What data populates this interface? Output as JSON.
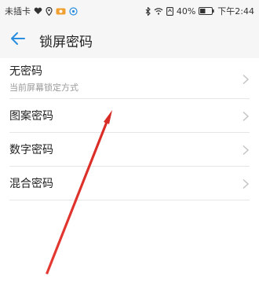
{
  "status_bar": {
    "carrier": "未插卡",
    "battery_percent": "40%",
    "time": "下午2:44",
    "left_icons": [
      "heart-icon",
      "location-icon",
      "eye-icon",
      "flower-icon"
    ],
    "right_icons": [
      "bluetooth-icon",
      "wifi-icon",
      "data-icon",
      "battery-icon"
    ]
  },
  "header": {
    "title": "锁屏密码"
  },
  "list": {
    "items": [
      {
        "label": "无密码",
        "subtitle": "当前屏幕锁定方式"
      },
      {
        "label": "图案密码"
      },
      {
        "label": "数字密码"
      },
      {
        "label": "混合密码"
      }
    ]
  },
  "colors": {
    "accent": "#2a8ee0",
    "arrow": "#e43a33",
    "background": "#ffffff",
    "header_bg": "#f6f6f6"
  }
}
